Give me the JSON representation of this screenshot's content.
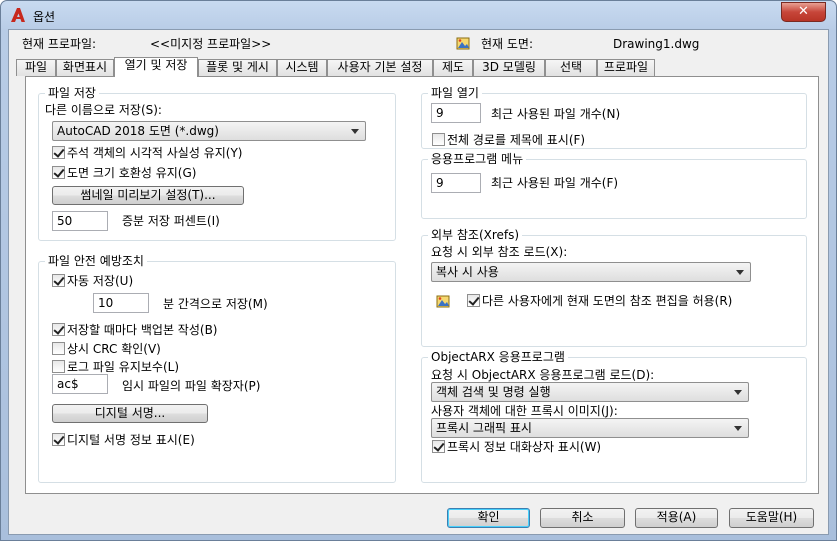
{
  "window": {
    "title": "옵션",
    "close_symbol": "✕"
  },
  "header": {
    "profile_label": "현재 프로파일:",
    "profile_value": "<<미지정 프로파일>>",
    "drawing_label": "현재 도면:",
    "drawing_value": "Drawing1.dwg"
  },
  "tabs": [
    {
      "label": "파일"
    },
    {
      "label": "화면표시"
    },
    {
      "label": "열기 및 저장"
    },
    {
      "label": "플롯 및 게시"
    },
    {
      "label": "시스템"
    },
    {
      "label": "사용자 기본 설정"
    },
    {
      "label": "제도"
    },
    {
      "label": "3D 모델링"
    },
    {
      "label": "선택"
    },
    {
      "label": "프로파일"
    }
  ],
  "file_save": {
    "title": "파일 저장",
    "save_as_label": "다른 이름으로 저장(S):",
    "save_as_value": "AutoCAD 2018 도면 (*.dwg)",
    "annot_visual": "주석 객체의 시각적 사실성 유지(Y)",
    "drawing_size": "도면 크기 호환성 유지(G)",
    "thumbnail_btn": "썸네일 미리보기 설정(T)...",
    "incremental_value": "50",
    "incremental_label": "증분 저장 퍼센트(I)"
  },
  "file_safety": {
    "title": "파일 안전 예방조치",
    "autosave": "자동 저장(U)",
    "minutes_value": "10",
    "minutes_label": "분 간격으로 저장(M)",
    "backup": "저장할 때마다 백업본 작성(B)",
    "crc": "상시 CRC 확인(V)",
    "log": "로그 파일 유지보수(L)",
    "ext_value": "ac$",
    "ext_label": "임시 파일의 파일 확장자(P)",
    "digsig_btn": "디지털 서명...",
    "digsig_show": "디지털 서명 정보 표시(E)"
  },
  "file_open": {
    "title": "파일 열기",
    "recent_value": "9",
    "recent_label": "최근 사용된 파일 개수(N)",
    "fullpath": "전체 경로를 제목에 표시(F)"
  },
  "app_menu": {
    "title": "응용프로그램 메뉴",
    "recent_value": "9",
    "recent_label": "최근 사용된 파일 개수(F)"
  },
  "xrefs": {
    "title": "외부 참조(Xrefs)",
    "demand_label": "요청 시 외부 참조 로드(X):",
    "demand_value": "복사 시 사용",
    "allow_edit": "다른 사용자에게 현재 도면의 참조 편집을 허용(R)"
  },
  "objectarx": {
    "title": "ObjectARX 응용프로그램",
    "demand_label": "요청 시 ObjectARX 응용프로그램 로드(D):",
    "demand_value": "객체 검색 및 명령 실행",
    "proxy_label": "사용자 객체에 대한 프록시 이미지(J):",
    "proxy_value": "프록시 그래픽 표시",
    "proxy_dialog": "프록시 정보 대화상자 표시(W)"
  },
  "footer": {
    "ok": "확인",
    "cancel": "취소",
    "apply": "적용(A)",
    "help": "도움말(H)"
  },
  "colors": {
    "accent_red": "#c7463a",
    "title_bg": "#b8cce6"
  }
}
